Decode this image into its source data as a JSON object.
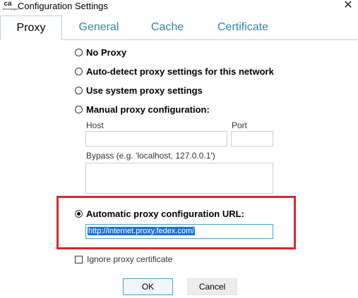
{
  "window": {
    "title": "Configuration Settings",
    "app_icon_text": "ca",
    "app_icon_subtext": "technologies",
    "close_glyph": "✕"
  },
  "tabs": [
    {
      "label": "Proxy",
      "active": true
    },
    {
      "label": "General",
      "active": false
    },
    {
      "label": "Cache",
      "active": false
    },
    {
      "label": "Certificate",
      "active": false
    }
  ],
  "proxy": {
    "options": [
      {
        "label": "No Proxy",
        "selected": false
      },
      {
        "label": "Auto-detect proxy settings for this network",
        "selected": false
      },
      {
        "label": "Use system proxy settings",
        "selected": false
      },
      {
        "label": "Manual proxy configuration:",
        "selected": false
      },
      {
        "label": "Automatic proxy configuration URL:",
        "selected": true
      }
    ],
    "host_label": "Host",
    "host_value": "",
    "port_label": "Port",
    "port_value": "",
    "bypass_label": "Bypass (e.g. 'localhost, 127.0.0.1')",
    "bypass_value": "",
    "auto_config_url": "http://internet.proxy.fedex.com/",
    "ignore_certificate_label": "Ignore proxy certificate",
    "ignore_certificate_checked": false
  },
  "buttons": {
    "ok": "OK",
    "cancel": "Cancel"
  },
  "colors": {
    "tab_inactive": "#2e84a8",
    "highlight_border": "#d9262a",
    "selection": "#1e6fd9"
  }
}
